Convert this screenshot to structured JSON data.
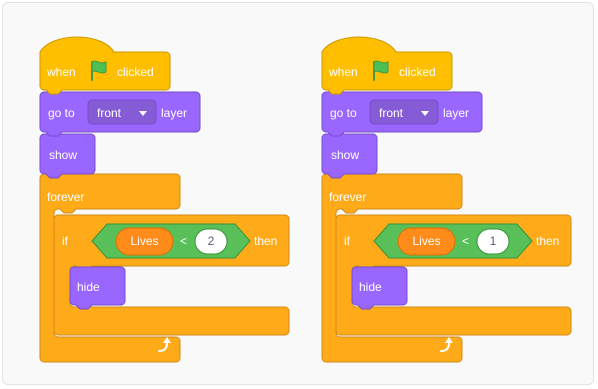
{
  "colors": {
    "events": "#FFBF00",
    "events_border": "#CC9900",
    "control": "#FFAB19",
    "control_border": "#CF8B17",
    "looks": "#9966FF",
    "looks_border": "#774DCB",
    "operators": "#59C059",
    "operators_border": "#389438",
    "variables": "#FF8C1A",
    "variables_border": "#DB6E00",
    "flag": "#4CBF56",
    "dropdown": "#855CD6"
  },
  "scripts": [
    {
      "hat": {
        "when": "when",
        "clicked": "clicked",
        "flag_icon": "green-flag-icon"
      },
      "goto": {
        "prefix": "go to",
        "dropdown": "front",
        "suffix": "layer"
      },
      "show": "show",
      "forever": "forever",
      "if": {
        "label": "if",
        "variable": "Lives",
        "operator": "<",
        "value": "2",
        "then": "then"
      },
      "hide": "hide",
      "loop_icon": "repeat-arrow-icon"
    },
    {
      "hat": {
        "when": "when",
        "clicked": "clicked",
        "flag_icon": "green-flag-icon"
      },
      "goto": {
        "prefix": "go to",
        "dropdown": "front",
        "suffix": "layer"
      },
      "show": "show",
      "forever": "forever",
      "if": {
        "label": "if",
        "variable": "Lives",
        "operator": "<",
        "value": "1",
        "then": "then"
      },
      "hide": "hide",
      "loop_icon": "repeat-arrow-icon"
    }
  ]
}
